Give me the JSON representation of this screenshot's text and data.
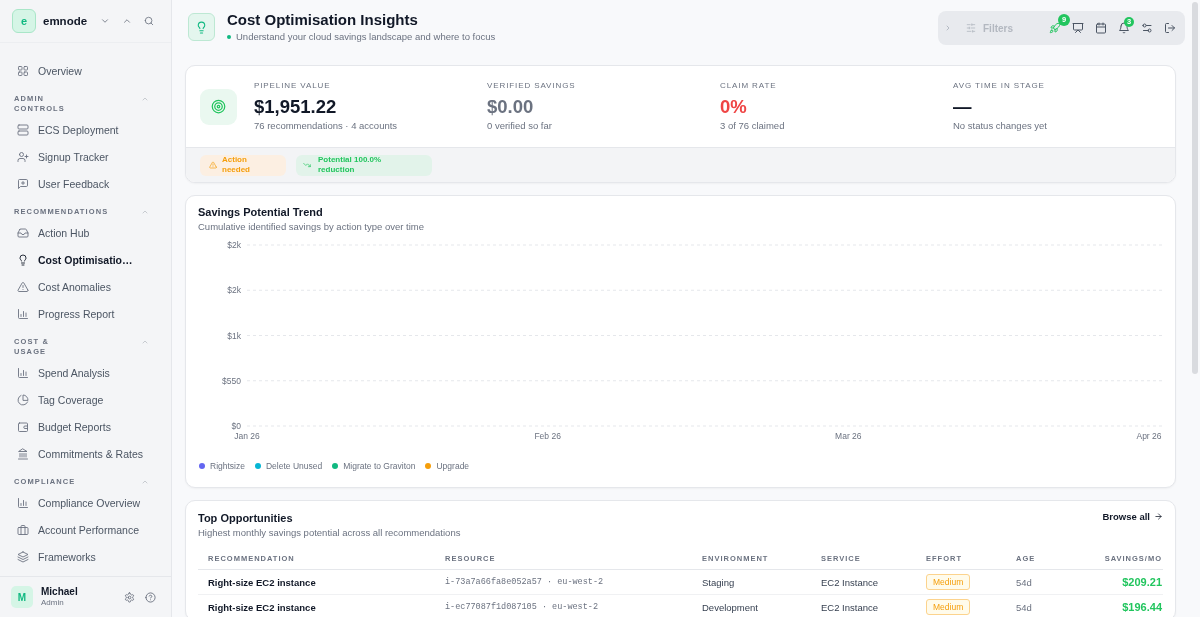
{
  "sidebar": {
    "brand": {
      "initial": "e",
      "name": "emnode"
    },
    "items": [
      {
        "label": "Overview",
        "selected": false
      }
    ],
    "sections": [
      {
        "title": "ADMIN CONTROLS",
        "expanded": true,
        "items": [
          {
            "label": "ECS Deployment",
            "selected": false
          },
          {
            "label": "Signup Tracker",
            "selected": false
          },
          {
            "label": "User Feedback",
            "selected": false
          }
        ]
      },
      {
        "title": "RECOMMENDATIONS",
        "expanded": true,
        "items": [
          {
            "label": "Action Hub",
            "selected": false
          },
          {
            "label": "Cost Optimisatio…",
            "selected": true
          },
          {
            "label": "Cost Anomalies",
            "selected": false
          },
          {
            "label": "Progress Report",
            "selected": false
          }
        ]
      },
      {
        "title": "COST & USAGE",
        "expanded": true,
        "items": [
          {
            "label": "Spend Analysis",
            "selected": false
          },
          {
            "label": "Tag Coverage",
            "selected": false
          },
          {
            "label": "Budget Reports",
            "selected": false
          },
          {
            "label": "Commitments & Rates",
            "selected": false
          }
        ]
      },
      {
        "title": "COMPLIANCE",
        "expanded": true,
        "items": [
          {
            "label": "Compliance Overview",
            "selected": false
          },
          {
            "label": "Account Performance",
            "selected": false
          },
          {
            "label": "Frameworks",
            "selected": false
          }
        ]
      }
    ],
    "user": {
      "initial": "M",
      "name": "Michael",
      "role": "Admin"
    }
  },
  "header": {
    "title": "Cost Optimisation Insights",
    "subtitle": "Understand your cloud savings landscape and where to focus"
  },
  "toolbar": {
    "filters_label": "Filters",
    "rocket_badge": "9",
    "bell_badge": "3"
  },
  "summary": {
    "stats": [
      {
        "label": "PIPELINE VALUE",
        "value": "$1,951.22",
        "note": "76 recommendations · 4 accounts",
        "color": "#111827"
      },
      {
        "label": "VERIFIED SAVINGS",
        "value": "$0.00",
        "note": "0 verified so far",
        "color": "#6b7280"
      },
      {
        "label": "CLAIM RATE",
        "value": "0%",
        "note": "3 of 76 claimed",
        "color": "#ef4444"
      },
      {
        "label": "AVG TIME IN STAGE",
        "value": "—",
        "note": "No status changes yet",
        "color": "#111827"
      }
    ],
    "callouts": [
      {
        "kind": "warning",
        "text": "Action needed"
      },
      {
        "kind": "success",
        "text": "Potential 100.0% reduction"
      }
    ]
  },
  "trend": {
    "subtitle": "Cumulative identified savings by action type over time",
    "chart_data": {
      "type": "line",
      "title": "Savings Potential Trend",
      "categories": [
        "Jan 26",
        "Feb 26",
        "Mar 26",
        "Apr 26"
      ],
      "series": [
        {
          "name": "Rightsize",
          "color": "#6366f1",
          "values": [
            null,
            null,
            null,
            null
          ]
        },
        {
          "name": "Delete Unused",
          "color": "#06b6d4",
          "values": [
            null,
            null,
            null,
            null
          ]
        },
        {
          "name": "Migrate to Graviton",
          "color": "#10b981",
          "values": [
            null,
            null,
            null,
            null
          ]
        },
        {
          "name": "Upgrade",
          "color": "#f59e0b",
          "values": [
            null,
            null,
            null,
            null
          ]
        }
      ],
      "ylim": [
        0,
        2200
      ],
      "yticks": [
        {
          "value": 0,
          "label": "$0"
        },
        {
          "value": 550,
          "label": "$550"
        },
        {
          "value": 1100,
          "label": "$1k"
        },
        {
          "value": 1650,
          "label": "$2k"
        },
        {
          "value": 2200,
          "label": "$2k"
        }
      ],
      "grid": true
    }
  },
  "opportunities": {
    "title": "Top Opportunities",
    "subtitle": "Highest monthly savings potential across all recommendations",
    "browse_label": "Browse all",
    "columns": [
      "RECOMMENDATION",
      "RESOURCE",
      "ENVIRONMENT",
      "SERVICE",
      "EFFORT",
      "AGE",
      "SAVINGS/MO"
    ],
    "rows": [
      {
        "recommendation": "Right-size EC2 instance",
        "resource": "i-73a7a66fa8e052a57 · eu-west-2",
        "environment": "Staging",
        "service": "EC2 Instance",
        "effort": "Medium",
        "age": "54d",
        "savings": "$209.21"
      },
      {
        "recommendation": "Right-size EC2 instance",
        "resource": "i-ec77087f1d087105 · eu-west-2",
        "environment": "Development",
        "service": "EC2 Instance",
        "effort": "Medium",
        "age": "54d",
        "savings": "$196.44"
      }
    ]
  }
}
